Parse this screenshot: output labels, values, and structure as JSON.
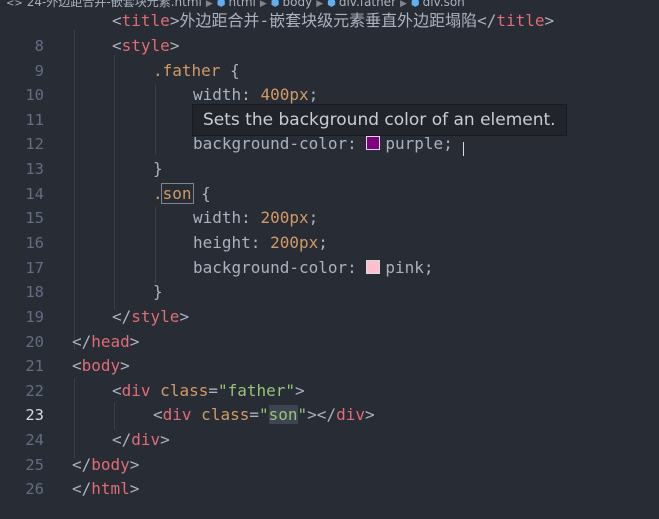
{
  "breadcrumb": {
    "file": "24-外边距合并-嵌套块元素.html",
    "items": [
      "html",
      "body",
      "div.father",
      "div.son"
    ]
  },
  "gutter": {
    "numbers": [
      "8",
      "9",
      "10",
      "11",
      "12",
      "13",
      "14",
      "15",
      "16",
      "17",
      "18",
      "19",
      "20",
      "21",
      "22",
      "23",
      "24",
      "25",
      "26"
    ]
  },
  "code": {
    "l7_open": "<",
    "l7_tag": "title",
    "l7_close": ">",
    "l7_text": "外边距合并-嵌套块级元素垂直外边距塌陷",
    "l7_end_open": "</",
    "l7_end_tag": "title",
    "l7_end_close": ">",
    "l8_open": "<",
    "l8_tag": "style",
    "l8_close": ">",
    "l9_sel": ".father",
    "l9_brace": " {",
    "l10_prop": "width: ",
    "l10_val": "400px",
    "l10_semi": ";",
    "l12_prop": "background-color: ",
    "l12_val": "purple",
    "l12_semi": ";",
    "l13_brace": "}",
    "l14_dot": ".",
    "l14_name": "son",
    "l14_brace": " {",
    "l15_prop": "width: ",
    "l15_val": "200px",
    "l15_semi": ";",
    "l16_prop": "height: ",
    "l16_val": "200px",
    "l16_semi": ";",
    "l17_prop": "background-color: ",
    "l17_val": "pink",
    "l17_semi": ";",
    "l18_brace": "}",
    "l19_open": "</",
    "l19_tag": "style",
    "l19_close": ">",
    "l20_open": "</",
    "l20_tag": "head",
    "l20_close": ">",
    "l21_open": "<",
    "l21_tag": "body",
    "l21_close": ">",
    "l22_open": "<",
    "l22_tag": "div",
    "l22_attr": " class",
    "l22_eq": "=",
    "l22_str": "\"father\"",
    "l22_close": ">",
    "l23_open": "<",
    "l23_tag": "div",
    "l23_attr": " class",
    "l23_eq": "=",
    "l23_q1": "\"",
    "l23_son": "son",
    "l23_q2": "\"",
    "l23_mid": "></",
    "l23_tag2": "div",
    "l23_close": ">",
    "l24_open": "</",
    "l24_tag": "div",
    "l24_close": ">",
    "l25_open": "</",
    "l25_tag": "body",
    "l25_close": ">",
    "l26_open": "</",
    "l26_tag": "html",
    "l26_close": ">"
  },
  "tooltip": {
    "text": "Sets the background color of an element."
  },
  "colors": {
    "background": "#282c34",
    "tag": "#e06c75",
    "attribute": "#d19a66",
    "string": "#98c379",
    "number": "#d19a66",
    "swatch_purple": "#800080",
    "swatch_pink": "#ffc0cb"
  }
}
